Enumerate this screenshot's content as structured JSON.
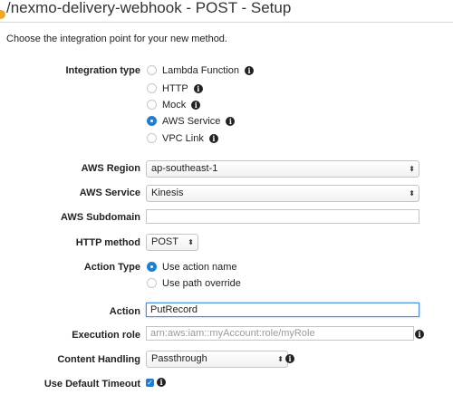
{
  "header": {
    "title": "/nexmo-delivery-webhook - POST - Setup"
  },
  "instructions": "Choose the integration point for your new method.",
  "integration_type": {
    "label": "Integration type",
    "options": [
      "Lambda Function",
      "HTTP",
      "Mock",
      "AWS Service",
      "VPC Link"
    ],
    "selected": "AWS Service"
  },
  "aws_region": {
    "label": "AWS Region",
    "value": "ap-southeast-1"
  },
  "aws_service": {
    "label": "AWS Service",
    "value": "Kinesis"
  },
  "aws_subdomain": {
    "label": "AWS Subdomain",
    "value": ""
  },
  "http_method": {
    "label": "HTTP method",
    "value": "POST"
  },
  "action_type": {
    "label": "Action Type",
    "options": [
      "Use action name",
      "Use path override"
    ],
    "selected": "Use action name"
  },
  "action": {
    "label": "Action",
    "value": "PutRecord"
  },
  "execution_role": {
    "label": "Execution role",
    "placeholder": "arn:aws:iam::myAccount:role/myRole"
  },
  "content_handling": {
    "label": "Content Handling",
    "value": "Passthrough"
  },
  "default_timeout": {
    "label": "Use Default Timeout",
    "checked": true
  },
  "colors": {
    "accent": "#1f7ed2",
    "header_icon": "#f5a623"
  }
}
